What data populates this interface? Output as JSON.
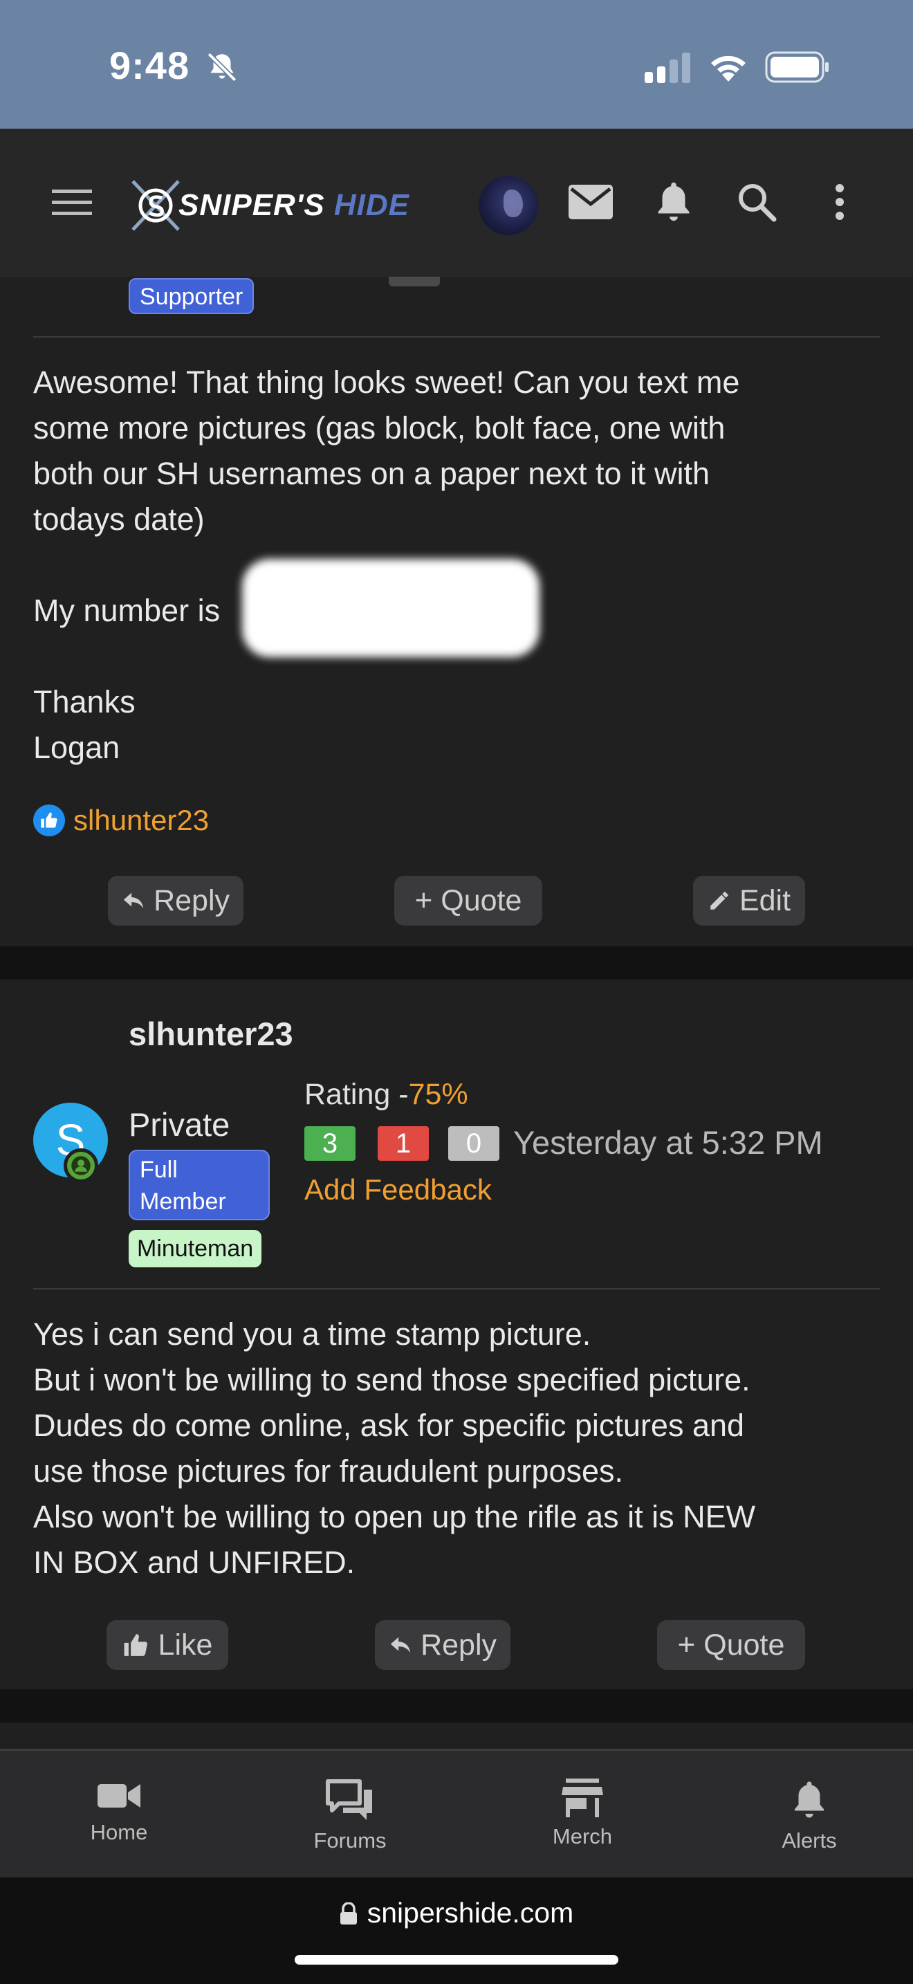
{
  "status_bar": {
    "time": "9:48"
  },
  "header": {
    "logo_main": "SNIPER'S",
    "logo_accent": "HIDE"
  },
  "post1": {
    "badge": "Supporter",
    "body_text": "Awesome! That thing looks sweet! Can you text me\nsome more pictures (gas block, bolt face, one with\nboth our SH usernames on a paper next to it with\ntodays date)",
    "number_label": "My number is",
    "closing": "Thanks\nLogan",
    "reaction_user": "slhunter23",
    "actions": {
      "reply": "Reply",
      "quote": "Quote",
      "edit": "Edit"
    }
  },
  "post2": {
    "avatar_letter": "S",
    "username": "slhunter23",
    "user_title": "Private",
    "badge_member": "Full Member",
    "badge_minuteman": "Minuteman",
    "rating_label": "Rating -",
    "rating_pct": "75%",
    "scores": {
      "positive": "3",
      "negative": "1",
      "neutral": "0"
    },
    "timestamp": "Yesterday at 5:32 PM",
    "add_feedback": "Add Feedback",
    "body_text": "Yes i can send you a time stamp picture.\nBut i won't be willing to send those specified picture.\nDudes do come online, ask for specific pictures and\nuse those pictures for fraudulent purposes.\nAlso won't be willing to open up the rifle as it is NEW\nIN BOX and UNFIRED.",
    "actions": {
      "like": "Like",
      "reply": "Reply",
      "quote": "Quote"
    }
  },
  "tabs": [
    {
      "label": "Home",
      "icon": "video-camera-icon"
    },
    {
      "label": "Forums",
      "icon": "chat-bubbles-icon"
    },
    {
      "label": "Merch",
      "icon": "store-icon"
    },
    {
      "label": "Alerts",
      "icon": "bell-icon"
    }
  ],
  "browser": {
    "url": "snipershide.com"
  },
  "colors": {
    "accent_orange": "#f0a030",
    "badge_blue": "#4161d6",
    "status_bar": "#6b84a3"
  }
}
